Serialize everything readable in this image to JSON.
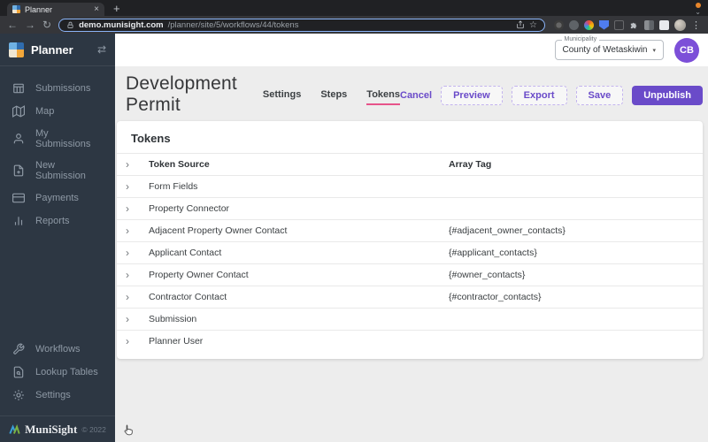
{
  "browser": {
    "tab_title": "Planner",
    "new_tab": "+",
    "close_glyph": "×",
    "back_glyph": "←",
    "forward_glyph": "→",
    "reload_glyph": "↻",
    "url_host": "demo.munisight.com",
    "url_path": "/planner/site/5/workflows/44/tokens",
    "star_glyph": "☆",
    "menu_glyph": "⋮",
    "tab_chevron": "⌄"
  },
  "sidebar": {
    "brand": "Planner",
    "collapse_glyph": "⇄",
    "items": [
      {
        "label": "Submissions",
        "icon": "table-icon"
      },
      {
        "label": "Map",
        "icon": "map-icon"
      },
      {
        "label": "My Submissions",
        "icon": "user-icon"
      },
      {
        "label": "New Submission",
        "icon": "file-plus-icon"
      },
      {
        "label": "Payments",
        "icon": "credit-card-icon"
      },
      {
        "label": "Reports",
        "icon": "bar-chart-icon"
      }
    ],
    "bottom_items": [
      {
        "label": "Workflows",
        "icon": "wrench-icon"
      },
      {
        "label": "Lookup Tables",
        "icon": "file-search-icon"
      },
      {
        "label": "Settings",
        "icon": "gear-icon"
      }
    ],
    "footer": {
      "brand": "MuniSight",
      "copyright": "© 2022"
    }
  },
  "topbar": {
    "municipality_label": "Municipality",
    "municipality_value": "County of Wetaskiwin",
    "dropdown_arrow": "▾",
    "avatar_initials": "CB"
  },
  "header": {
    "title": "Development Permit",
    "tabs": [
      {
        "label": "Settings",
        "active": false
      },
      {
        "label": "Steps",
        "active": false
      },
      {
        "label": "Tokens",
        "active": true
      }
    ],
    "actions": {
      "cancel": "Cancel",
      "preview": "Preview",
      "export": "Export",
      "save": "Save",
      "unpublish": "Unpublish"
    }
  },
  "tokens_panel": {
    "title": "Tokens",
    "columns": {
      "source": "Token Source",
      "array_tag": "Array Tag"
    },
    "chevron_glyph": "›",
    "rows": [
      {
        "label": "Form Fields",
        "tag": ""
      },
      {
        "label": "Property Connector",
        "tag": ""
      },
      {
        "label": "Adjacent Property Owner Contact",
        "tag": "{#adjacent_owner_contacts}"
      },
      {
        "label": "Applicant Contact",
        "tag": "{#applicant_contacts}"
      },
      {
        "label": "Property Owner Contact",
        "tag": "{#owner_contacts}"
      },
      {
        "label": "Contractor Contact",
        "tag": "{#contractor_contacts}"
      },
      {
        "label": "Submission",
        "tag": ""
      },
      {
        "label": "Planner User",
        "tag": ""
      }
    ]
  },
  "colors": {
    "accent": "#6a4bc9",
    "accent_light": "#c3b4ee",
    "tab_underline": "#e7538a",
    "sidebar_bg": "#2d3743",
    "sidebar_text": "#8e99a5",
    "avatar_bg": "#7c4fd8",
    "chrome_dark": "#202124",
    "chrome_mid": "#35363a",
    "url_focus": "#8ab4f8",
    "content_bg": "#ededed"
  }
}
